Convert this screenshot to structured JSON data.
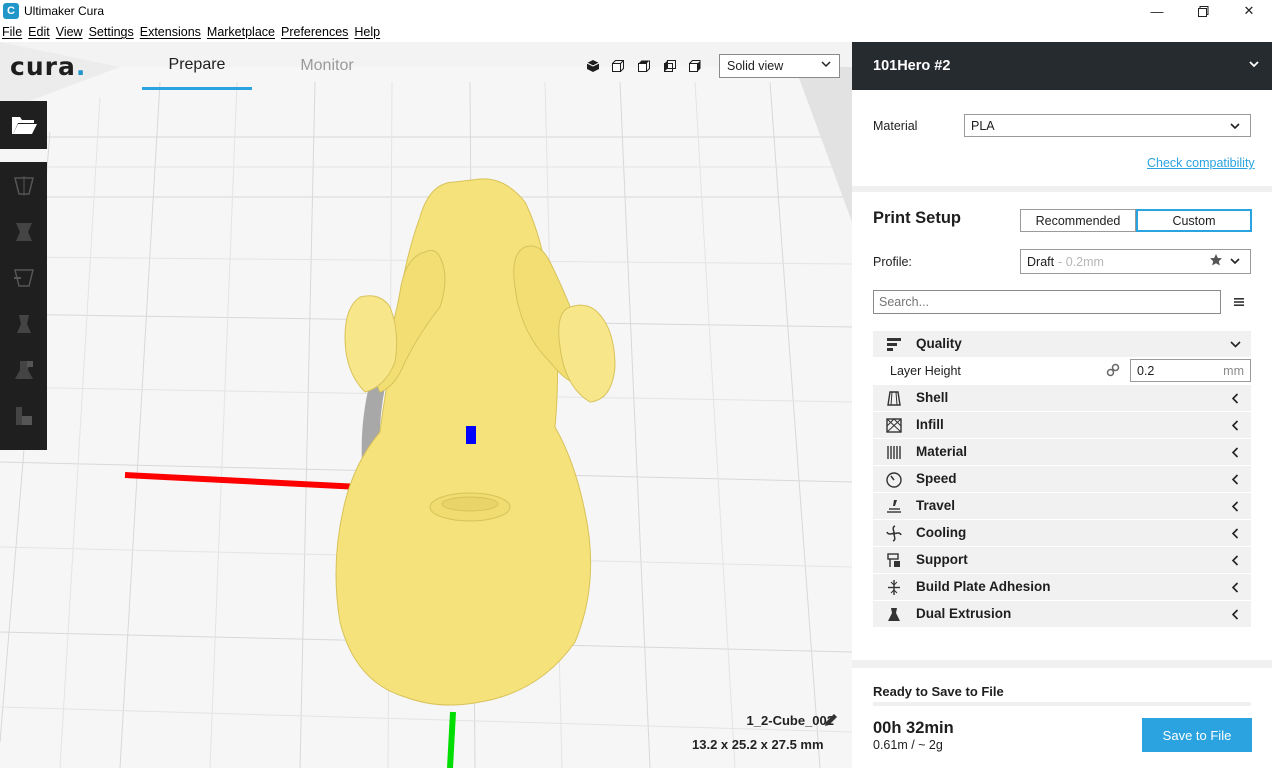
{
  "window": {
    "title": "Ultimaker Cura",
    "app_icon_glyph": "C"
  },
  "menu": [
    "File",
    "Edit",
    "View",
    "Settings",
    "Extensions",
    "Marketplace",
    "Preferences",
    "Help"
  ],
  "header": {
    "logo_text": "cura",
    "logo_dot": ".",
    "tabs": [
      {
        "label": "Prepare",
        "active": true
      },
      {
        "label": "Monitor",
        "active": false
      }
    ],
    "view_icons": [
      "3d-view-icon",
      "front-view-icon",
      "top-view-icon",
      "left-view-icon",
      "right-view-icon"
    ],
    "view_mode": "Solid view"
  },
  "left_toolbar": {
    "open_icon": "folder-open-icon",
    "tools": [
      "move-tool-icon",
      "scale-tool-icon",
      "rotate-tool-icon",
      "mirror-tool-icon",
      "per-model-settings-icon",
      "support-blocker-icon"
    ]
  },
  "object": {
    "name": "1_2-Cube_002",
    "dimensions": "13.2 x 25.2 x 27.5 mm"
  },
  "panel": {
    "printer_name": "101Hero #2",
    "material_label": "Material",
    "material_value": "PLA",
    "check_compatibility": "Check compatibility",
    "print_setup_title": "Print Setup",
    "mode_buttons": {
      "recommended": "Recommended",
      "custom": "Custom",
      "active": "Custom"
    },
    "profile_label": "Profile:",
    "profile_value": "Draft",
    "profile_sub": " - 0.2mm",
    "search_placeholder": "Search...",
    "categories": [
      {
        "label": "Quality",
        "icon": "quality-icon",
        "expanded": true
      },
      {
        "label": "Shell",
        "icon": "shell-icon",
        "expanded": false
      },
      {
        "label": "Infill",
        "icon": "infill-icon",
        "expanded": false
      },
      {
        "label": "Material",
        "icon": "material-icon",
        "expanded": false
      },
      {
        "label": "Speed",
        "icon": "speed-icon",
        "expanded": false
      },
      {
        "label": "Travel",
        "icon": "travel-icon",
        "expanded": false
      },
      {
        "label": "Cooling",
        "icon": "cooling-icon",
        "expanded": false
      },
      {
        "label": "Support",
        "icon": "support-icon",
        "expanded": false
      },
      {
        "label": "Build Plate Adhesion",
        "icon": "adhesion-icon",
        "expanded": false
      },
      {
        "label": "Dual Extrusion",
        "icon": "dual-extrusion-icon",
        "expanded": false
      }
    ],
    "layer_height": {
      "label": "Layer Height",
      "value": "0.2",
      "unit": "mm"
    },
    "ready_label": "Ready to Save to File",
    "print_time": "00h 32min",
    "print_usage": "0.61m / ~ 2g",
    "save_button": "Save to File"
  },
  "colors": {
    "accent": "#2aa3e0",
    "panel_dark": "#262b30",
    "model_yellow": "#f5e27a",
    "axis_x": "#ff0000",
    "axis_y": "#00dd00",
    "axis_z": "#0000ff"
  }
}
